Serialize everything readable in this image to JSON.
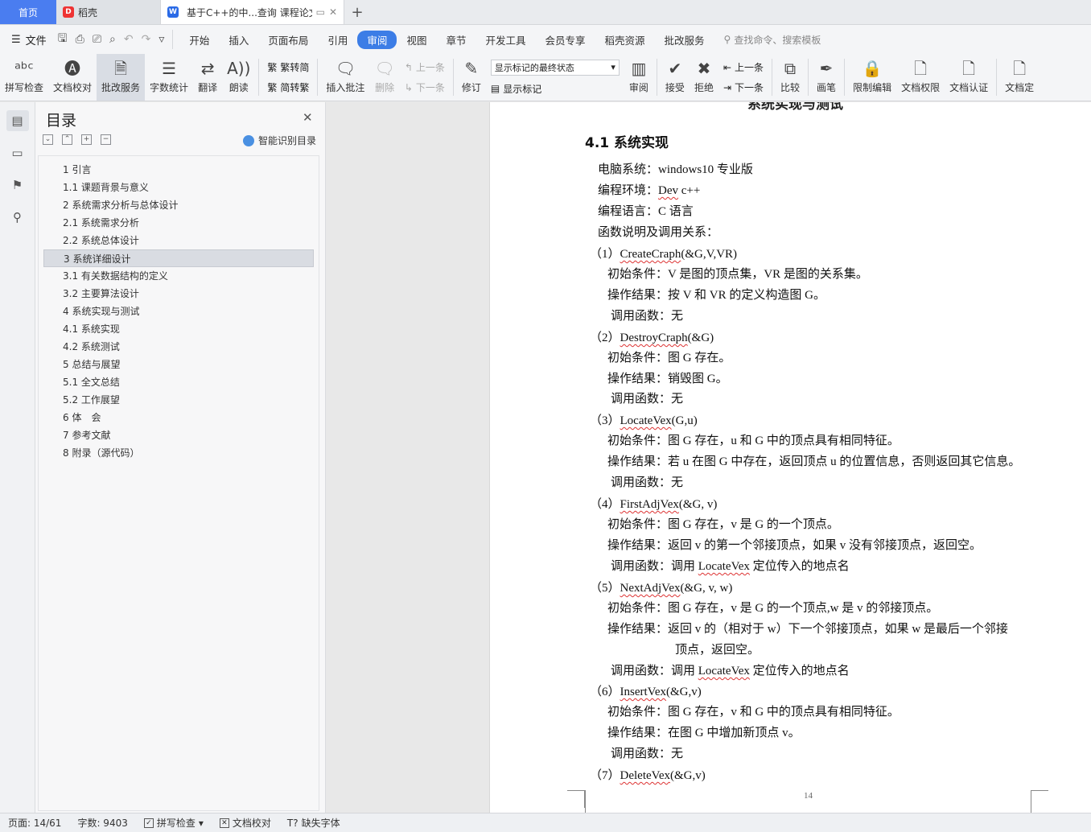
{
  "tabs": {
    "home": "首页",
    "daoke": "稻壳",
    "doc_title": "基于C++的中...查询 课程论文"
  },
  "menu": {
    "file": "文件",
    "items": [
      "开始",
      "插入",
      "页面布局",
      "引用",
      "审阅",
      "视图",
      "章节",
      "开发工具",
      "会员专享",
      "稻壳资源",
      "批改服务"
    ],
    "active": "审阅",
    "search_placeholder": "查找命令、搜索模板"
  },
  "ribbon": {
    "spell": "拼写检查",
    "proof": "文档校对",
    "review_service": "批改服务",
    "wordcount": "字数统计",
    "translate": "翻译",
    "read": "朗读",
    "to_simplified": "繁转简",
    "to_traditional": "简转繁",
    "insert_comment": "插入批注",
    "delete": "删除",
    "prev": "上一条",
    "next": "下一条",
    "revise": "修订",
    "markup_select": "显示标记的最终状态",
    "show_markup": "显示标记",
    "review": "审阅",
    "accept": "接受",
    "reject": "拒绝",
    "prev2": "上一条",
    "next2": "下一条",
    "compare": "比较",
    "pen": "画笔",
    "restrict": "限制编辑",
    "rights": "文档权限",
    "certify": "文档认证",
    "finalize": "文档定"
  },
  "toc": {
    "title": "目录",
    "ai_label": "智能识别目录",
    "items": [
      "1 引言",
      "1.1 课题背景与意义",
      "2 系统需求分析与总体设计",
      "2.1 系统需求分析",
      "2.2 系统总体设计",
      "3 系统详细设计",
      "3.1 有关数据结构的定义",
      "3.2 主要算法设计",
      "4 系统实现与测试",
      "4.1 系统实现",
      "4.2 系统测试",
      "5 总结与展望",
      "5.1 全文总结",
      "5.2 工作展望",
      "6 体　会",
      "7 参考文献",
      "8 附录（源代码）"
    ],
    "selected_index": 5
  },
  "doc": {
    "prev_heading": "系统实现与测试",
    "section_title": "4.1 系统实现",
    "lines": [
      "电脑系统：windows10 专业版",
      "编程环境：Dev c++",
      "编程语言：C 语言",
      "函数说明及调用关系：",
      "（1）CreateCraph(&G,V,VR)",
      "初始条件：V 是图的顶点集，VR 是图的关系集。",
      "操作结果：按 V 和 VR 的定义构造图 G。",
      "调用函数：无",
      "（2）DestroyCraph(&G)",
      "初始条件：图 G 存在。",
      "操作结果：销毁图 G。",
      "调用函数：无",
      "（3）LocateVex(G,u)",
      "初始条件：图 G 存在，u 和 G 中的顶点具有相同特征。",
      "操作结果：若 u 在图 G 中存在，返回顶点 u 的位置信息，否则返回其它信息。",
      "调用函数：无",
      "（4）FirstAdjVex(&G, v)",
      "初始条件：图 G 存在，v 是 G 的一个顶点。",
      "操作结果：返回 v 的第一个邻接顶点，如果 v 没有邻接顶点，返回空。",
      "调用函数：调用 LocateVex 定位传入的地点名",
      "（5）NextAdjVex(&G, v, w)",
      "初始条件：图 G 存在，v 是 G 的一个顶点,w 是 v 的邻接顶点。",
      "操作结果：返回 v 的（相对于 w）下一个邻接顶点，如果 w 是最后一个邻接",
      "顶点，返回空。",
      "调用函数：调用 LocateVex 定位传入的地点名",
      "（6）InsertVex(&G,v)",
      "初始条件：图 G 存在，v 和 G 中的顶点具有相同特征。",
      "操作结果：在图 G 中增加新顶点 v。",
      "调用函数：无",
      "（7）DeleteVex(&G,v)"
    ],
    "page_number": "14"
  },
  "status": {
    "page": "页面: 14/61",
    "words": "字数: 9403",
    "spell": "拼写检查",
    "proof": "文档校对",
    "missing_font": "缺失字体"
  }
}
